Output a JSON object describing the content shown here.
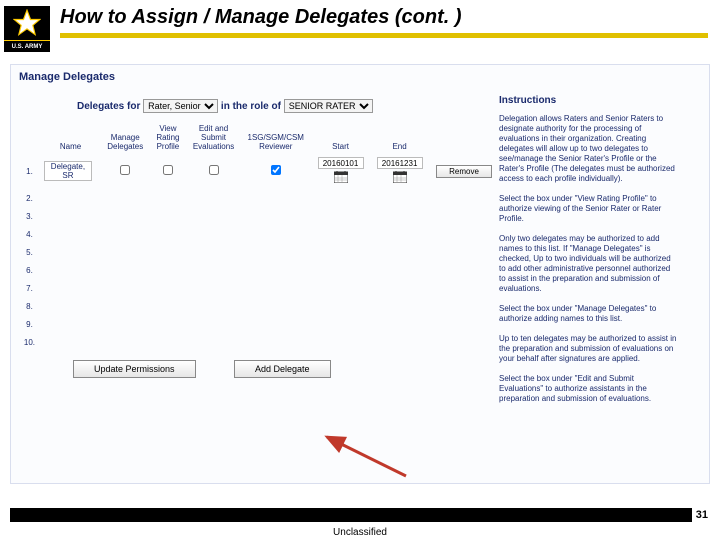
{
  "header": {
    "logo_sub": "U.S. ARMY",
    "title": "How to Assign / Manage Delegates (cont. )"
  },
  "panel": {
    "title": "Manage Delegates",
    "delegates_for_label": "Delegates for",
    "delegates_for_value": "Rater, Senior",
    "in_role_label": "in the role of",
    "role_value": "SENIOR RATER"
  },
  "columns": {
    "name": "Name",
    "manage": "Manage\nDelegates",
    "view": "View\nRating\nProfile",
    "edit": "Edit and\nSubmit\nEvaluations",
    "sgm": "1SG/SGM/CSM\nReviewer",
    "start": "Start",
    "end": "End"
  },
  "row": {
    "name": "Delegate, SR",
    "start": "20160101",
    "end": "20161231",
    "remove": "Remove"
  },
  "buttons": {
    "update": "Update Permissions",
    "add": "Add Delegate"
  },
  "instructions": {
    "title": "Instructions",
    "p1": "Delegation allows Raters and Senior Raters to designate authority for the processing of evaluations in their organization. Creating delegates will allow up to two delegates to see/manage the Senior Rater's Profile or the Rater's Profile (The delegates must be authorized access to each profile individually).",
    "p2": "Select the box under \"View Rating Profile\" to authorize viewing of the Senior Rater or Rater Profile.",
    "p3": "Only two delegates may be authorized to add names to this list. If \"Manage Delegates\" is checked, Up to two individuals will be authorized to add other administrative personnel authorized to assist in the preparation and submission of evaluations.",
    "p4": "Select the box under \"Manage Delegates\" to authorize adding names to this list.",
    "p5": "Up to ten delegates may be authorized to assist in the preparation and submission of evaluations on your behalf after signatures are applied.",
    "p6": "Select the box under \"Edit and Submit Evaluations\" to authorize assistants in the preparation and submission of evaluations."
  },
  "footer": {
    "classification": "Unclassified",
    "page": "31"
  }
}
